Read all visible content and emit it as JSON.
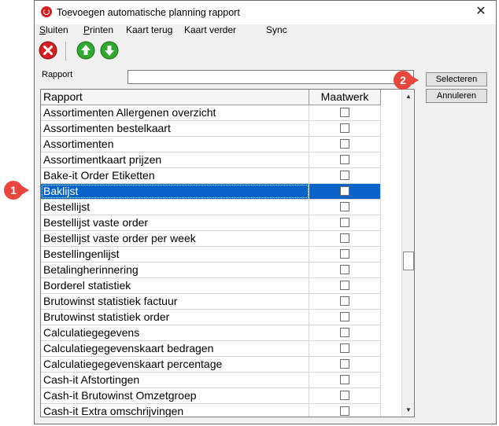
{
  "window": {
    "title": "Toevoegen automatische planning rapport",
    "close_glyph": "✕"
  },
  "menu": [
    {
      "label": "Sluiten",
      "underline": "S",
      "rest": "luiten"
    },
    {
      "label": "Printen",
      "underline": "P",
      "rest": "rinten"
    },
    {
      "label": "Kaart terug"
    },
    {
      "label": "Kaart verder"
    },
    {
      "label": "Sync"
    }
  ],
  "toolbar": {
    "close_icon": "red-x-circle-icon",
    "up_icon": "green-arrow-up-icon",
    "down_icon": "green-arrow-down-icon"
  },
  "rapport_label": "Rapport",
  "rapport_input": {
    "value": "",
    "placeholder": ""
  },
  "buttons": {
    "select": "Selecteren",
    "cancel": "Annuleren"
  },
  "grid": {
    "columns": [
      "Rapport",
      "Maatwerk"
    ],
    "rows": [
      "Assortimenten Allergenen overzicht",
      "Assortimenten bestelkaart",
      "Assortimenten",
      "Assortimentkaart prijzen",
      "Bake-it Order Etiketten",
      "Baklijst",
      "Bestellijst",
      "Bestellijst vaste order",
      "Bestellijst vaste order per week",
      "Bestellingenlijst",
      "Betalingherinnering",
      "Borderel statistiek",
      "Brutowinst statistiek factuur",
      "Brutowinst statistiek order",
      "Calculatiegegevens",
      "Calculatiegegevenskaart bedragen",
      "Calculatiegegevenskaart percentage",
      "Cash-it Afstortingen",
      "Cash-it Brutowinst Omzetgroep",
      "Cash-it Extra omschrijvingen"
    ],
    "selected_row": "Baklijst"
  },
  "callouts": [
    "1",
    "2"
  ],
  "colors": {
    "selection": "#0a64c8",
    "callout": "#e8453c",
    "toolbar_green": "#2faa2f",
    "toolbar_red": "#d42020"
  }
}
